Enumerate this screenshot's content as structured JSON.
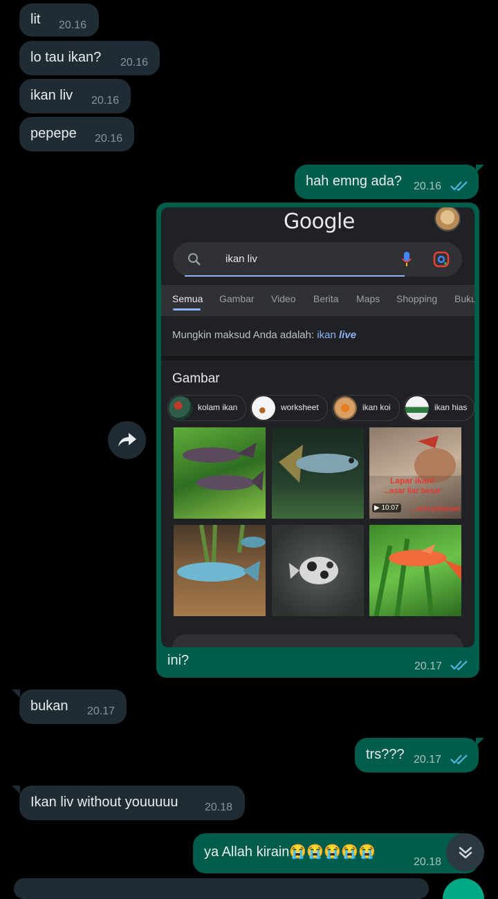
{
  "messages": [
    {
      "text": "lit",
      "time": "20.16"
    },
    {
      "text": "lo tau ikan?",
      "time": "20.16"
    },
    {
      "text": "ikan liv",
      "time": "20.16"
    },
    {
      "text": "pepepe",
      "time": "20.16"
    },
    {
      "text": "hah emng ada?",
      "time": "20.16"
    },
    {
      "text": "ini?",
      "time": "20.17"
    },
    {
      "text": "bukan",
      "time": "20.17"
    },
    {
      "text": "trs???",
      "time": "20.17"
    },
    {
      "text": "Ikan liv without youuuuu",
      "time": "20.18"
    },
    {
      "text": "ya Allah kirain😭😭😭😭😭",
      "time": "20.18"
    }
  ],
  "screenshot": {
    "logo": "Google",
    "search_query": "ikan liv",
    "tabs": [
      "Semua",
      "Gambar",
      "Video",
      "Berita",
      "Maps",
      "Shopping",
      "Buku"
    ],
    "did_you_mean_prefix": "Mungkin maksud Anda adalah:",
    "did_you_mean_plain": "ikan",
    "did_you_mean_bold": "live",
    "section_title": "Gambar",
    "chips": [
      "kolam ikan",
      "worksheet",
      "ikan koi",
      "ikan hias"
    ],
    "video_duration": "10:07",
    "overlay_text": [
      "Lapar ikan!",
      "...asar liar besar",
      "...er/customer"
    ]
  },
  "colors": {
    "incoming_bubble": "#1f2c33",
    "outgoing_bubble": "#005c4b",
    "read_tick": "#53bdeb",
    "link": "#8ab4f8"
  },
  "icons": [
    "forward-icon",
    "scroll-down-icon",
    "search-icon",
    "mic-icon",
    "lens-icon",
    "double-check-icon"
  ]
}
